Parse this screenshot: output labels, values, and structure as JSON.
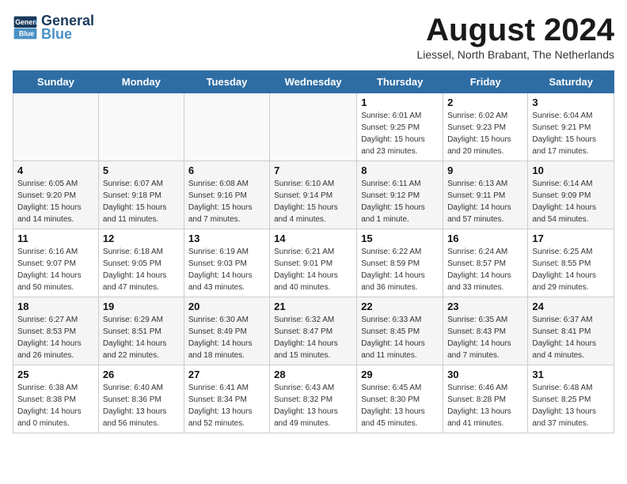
{
  "header": {
    "logo_line1": "General",
    "logo_line2": "Blue",
    "month_title": "August 2024",
    "subtitle": "Liessel, North Brabant, The Netherlands"
  },
  "weekdays": [
    "Sunday",
    "Monday",
    "Tuesday",
    "Wednesday",
    "Thursday",
    "Friday",
    "Saturday"
  ],
  "weeks": [
    [
      {
        "day": "",
        "info": ""
      },
      {
        "day": "",
        "info": ""
      },
      {
        "day": "",
        "info": ""
      },
      {
        "day": "",
        "info": ""
      },
      {
        "day": "1",
        "info": "Sunrise: 6:01 AM\nSunset: 9:25 PM\nDaylight: 15 hours and 23 minutes."
      },
      {
        "day": "2",
        "info": "Sunrise: 6:02 AM\nSunset: 9:23 PM\nDaylight: 15 hours and 20 minutes."
      },
      {
        "day": "3",
        "info": "Sunrise: 6:04 AM\nSunset: 9:21 PM\nDaylight: 15 hours and 17 minutes."
      }
    ],
    [
      {
        "day": "4",
        "info": "Sunrise: 6:05 AM\nSunset: 9:20 PM\nDaylight: 15 hours and 14 minutes."
      },
      {
        "day": "5",
        "info": "Sunrise: 6:07 AM\nSunset: 9:18 PM\nDaylight: 15 hours and 11 minutes."
      },
      {
        "day": "6",
        "info": "Sunrise: 6:08 AM\nSunset: 9:16 PM\nDaylight: 15 hours and 7 minutes."
      },
      {
        "day": "7",
        "info": "Sunrise: 6:10 AM\nSunset: 9:14 PM\nDaylight: 15 hours and 4 minutes."
      },
      {
        "day": "8",
        "info": "Sunrise: 6:11 AM\nSunset: 9:12 PM\nDaylight: 15 hours and 1 minute."
      },
      {
        "day": "9",
        "info": "Sunrise: 6:13 AM\nSunset: 9:11 PM\nDaylight: 14 hours and 57 minutes."
      },
      {
        "day": "10",
        "info": "Sunrise: 6:14 AM\nSunset: 9:09 PM\nDaylight: 14 hours and 54 minutes."
      }
    ],
    [
      {
        "day": "11",
        "info": "Sunrise: 6:16 AM\nSunset: 9:07 PM\nDaylight: 14 hours and 50 minutes."
      },
      {
        "day": "12",
        "info": "Sunrise: 6:18 AM\nSunset: 9:05 PM\nDaylight: 14 hours and 47 minutes."
      },
      {
        "day": "13",
        "info": "Sunrise: 6:19 AM\nSunset: 9:03 PM\nDaylight: 14 hours and 43 minutes."
      },
      {
        "day": "14",
        "info": "Sunrise: 6:21 AM\nSunset: 9:01 PM\nDaylight: 14 hours and 40 minutes."
      },
      {
        "day": "15",
        "info": "Sunrise: 6:22 AM\nSunset: 8:59 PM\nDaylight: 14 hours and 36 minutes."
      },
      {
        "day": "16",
        "info": "Sunrise: 6:24 AM\nSunset: 8:57 PM\nDaylight: 14 hours and 33 minutes."
      },
      {
        "day": "17",
        "info": "Sunrise: 6:25 AM\nSunset: 8:55 PM\nDaylight: 14 hours and 29 minutes."
      }
    ],
    [
      {
        "day": "18",
        "info": "Sunrise: 6:27 AM\nSunset: 8:53 PM\nDaylight: 14 hours and 26 minutes."
      },
      {
        "day": "19",
        "info": "Sunrise: 6:29 AM\nSunset: 8:51 PM\nDaylight: 14 hours and 22 minutes."
      },
      {
        "day": "20",
        "info": "Sunrise: 6:30 AM\nSunset: 8:49 PM\nDaylight: 14 hours and 18 minutes."
      },
      {
        "day": "21",
        "info": "Sunrise: 6:32 AM\nSunset: 8:47 PM\nDaylight: 14 hours and 15 minutes."
      },
      {
        "day": "22",
        "info": "Sunrise: 6:33 AM\nSunset: 8:45 PM\nDaylight: 14 hours and 11 minutes."
      },
      {
        "day": "23",
        "info": "Sunrise: 6:35 AM\nSunset: 8:43 PM\nDaylight: 14 hours and 7 minutes."
      },
      {
        "day": "24",
        "info": "Sunrise: 6:37 AM\nSunset: 8:41 PM\nDaylight: 14 hours and 4 minutes."
      }
    ],
    [
      {
        "day": "25",
        "info": "Sunrise: 6:38 AM\nSunset: 8:38 PM\nDaylight: 14 hours and 0 minutes."
      },
      {
        "day": "26",
        "info": "Sunrise: 6:40 AM\nSunset: 8:36 PM\nDaylight: 13 hours and 56 minutes."
      },
      {
        "day": "27",
        "info": "Sunrise: 6:41 AM\nSunset: 8:34 PM\nDaylight: 13 hours and 52 minutes."
      },
      {
        "day": "28",
        "info": "Sunrise: 6:43 AM\nSunset: 8:32 PM\nDaylight: 13 hours and 49 minutes."
      },
      {
        "day": "29",
        "info": "Sunrise: 6:45 AM\nSunset: 8:30 PM\nDaylight: 13 hours and 45 minutes."
      },
      {
        "day": "30",
        "info": "Sunrise: 6:46 AM\nSunset: 8:28 PM\nDaylight: 13 hours and 41 minutes."
      },
      {
        "day": "31",
        "info": "Sunrise: 6:48 AM\nSunset: 8:25 PM\nDaylight: 13 hours and 37 minutes."
      }
    ]
  ]
}
